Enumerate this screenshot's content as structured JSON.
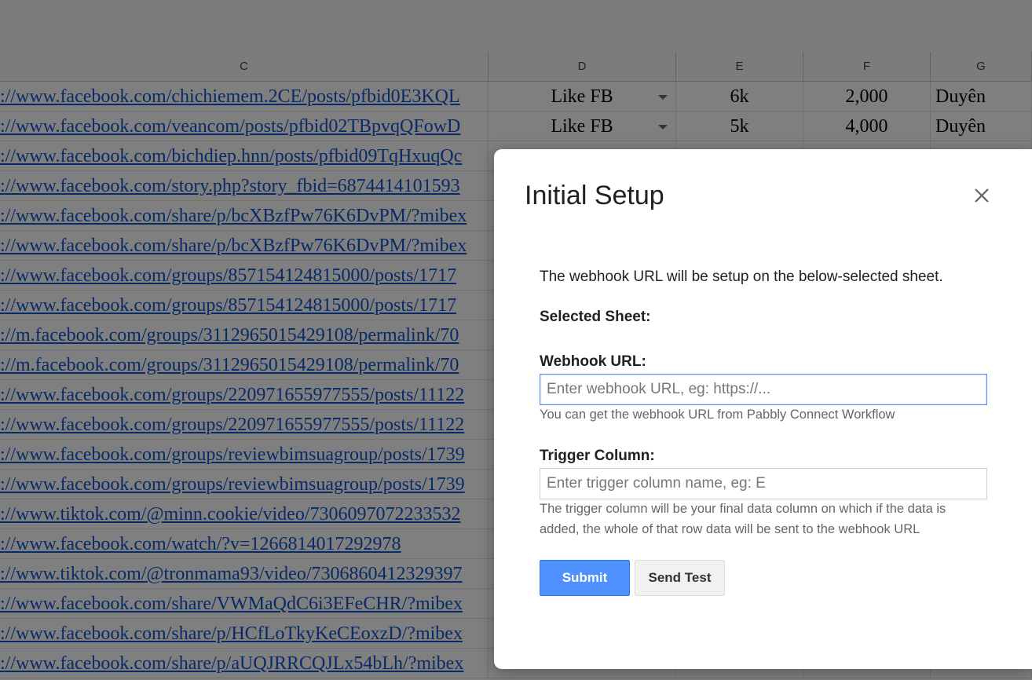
{
  "sheet": {
    "columns": [
      "C",
      "D",
      "E",
      "F",
      "G"
    ],
    "rows": [
      {
        "c": "://www.facebook.com/chichiemem.2CE/posts/pfbid0E3KQL",
        "d": "Like FB",
        "e": "6k",
        "f": "2,000",
        "g": "Duyên"
      },
      {
        "c": "://www.facebook.com/veancom/posts/pfbid02TBpvqQFowD",
        "d": "Like FB",
        "e": "5k",
        "f": "4,000",
        "g": "Duyên"
      },
      {
        "c": "://www.facebook.com/bichdiep.hnn/posts/pfbid09TqHxuqQc",
        "d": "",
        "e": "",
        "f": "",
        "g": ""
      },
      {
        "c": "://www.facebook.com/story.php?story_fbid=6874414101593",
        "d": "",
        "e": "",
        "f": "",
        "g": ""
      },
      {
        "c": "://www.facebook.com/share/p/bcXBzfPw76K6DvPM/?mibex",
        "d": "",
        "e": "",
        "f": "",
        "g": ""
      },
      {
        "c": "://www.facebook.com/share/p/bcXBzfPw76K6DvPM/?mibex",
        "d": "",
        "e": "",
        "f": "",
        "g": ""
      },
      {
        "c": "://www.facebook.com/groups/857154124815000/posts/1717",
        "d": "",
        "e": "",
        "f": "",
        "g": ""
      },
      {
        "c": "://www.facebook.com/groups/857154124815000/posts/1717",
        "d": "",
        "e": "",
        "f": "",
        "g": ""
      },
      {
        "c": "://m.facebook.com/groups/3112965015429108/permalink/70",
        "d": "",
        "e": "",
        "f": "",
        "g": ""
      },
      {
        "c": "://m.facebook.com/groups/3112965015429108/permalink/70",
        "d": "",
        "e": "",
        "f": "",
        "g": ""
      },
      {
        "c": "://www.facebook.com/groups/220971655977555/posts/11122",
        "d": "",
        "e": "",
        "f": "",
        "g": ""
      },
      {
        "c": "://www.facebook.com/groups/220971655977555/posts/11122",
        "d": "",
        "e": "",
        "f": "",
        "g": ""
      },
      {
        "c": "://www.facebook.com/groups/reviewbimsuagroup/posts/1739",
        "d": "",
        "e": "",
        "f": "",
        "g": ""
      },
      {
        "c": "://www.facebook.com/groups/reviewbimsuagroup/posts/1739",
        "d": "",
        "e": "",
        "f": "",
        "g": ""
      },
      {
        "c": "://www.tiktok.com/@minn.cookie/video/7306097072233532",
        "d": "",
        "e": "",
        "f": "",
        "g": ""
      },
      {
        "c": "://www.facebook.com/watch/?v=1266814017292978",
        "d": "",
        "e": "",
        "f": "",
        "g": ""
      },
      {
        "c": "://www.tiktok.com/@tronmama93/video/7306860412329397",
        "d": "",
        "e": "",
        "f": "",
        "g": ""
      },
      {
        "c": "://www.facebook.com/share/VWMaQdC6i3EFeCHR/?mibex",
        "d": "",
        "e": "",
        "f": "",
        "g": ""
      },
      {
        "c": "://www.facebook.com/share/p/HCfLoTkyKeCEoxzD/?mibex",
        "d": "",
        "e": "",
        "f": "",
        "g": ""
      },
      {
        "c": "://www.facebook.com/share/p/aUQJRRCQJLx54bLh/?mibex",
        "d": "",
        "e": "",
        "f": "",
        "g": ""
      }
    ]
  },
  "dialog": {
    "title": "Initial Setup",
    "description": "The webhook URL will be setup on the below-selected sheet.",
    "selected_sheet_label": "Selected Sheet:",
    "webhook_label": "Webhook URL:",
    "webhook_placeholder": "Enter webhook URL, eg: https://...",
    "webhook_value": "",
    "webhook_help": "You can get the webhook URL from Pabbly Connect Workflow",
    "trigger_label": "Trigger Column:",
    "trigger_placeholder": "Enter trigger column name, eg: E",
    "trigger_value": "",
    "trigger_help": "The trigger column will be your final data column on which if the data is added, the whole of that row data will be sent to the webhook URL",
    "submit_label": "Submit",
    "send_test_label": "Send Test",
    "close_icon": "close-icon",
    "colors": {
      "submit": "#4d90fe",
      "focus_border": "#4d90fe"
    }
  }
}
